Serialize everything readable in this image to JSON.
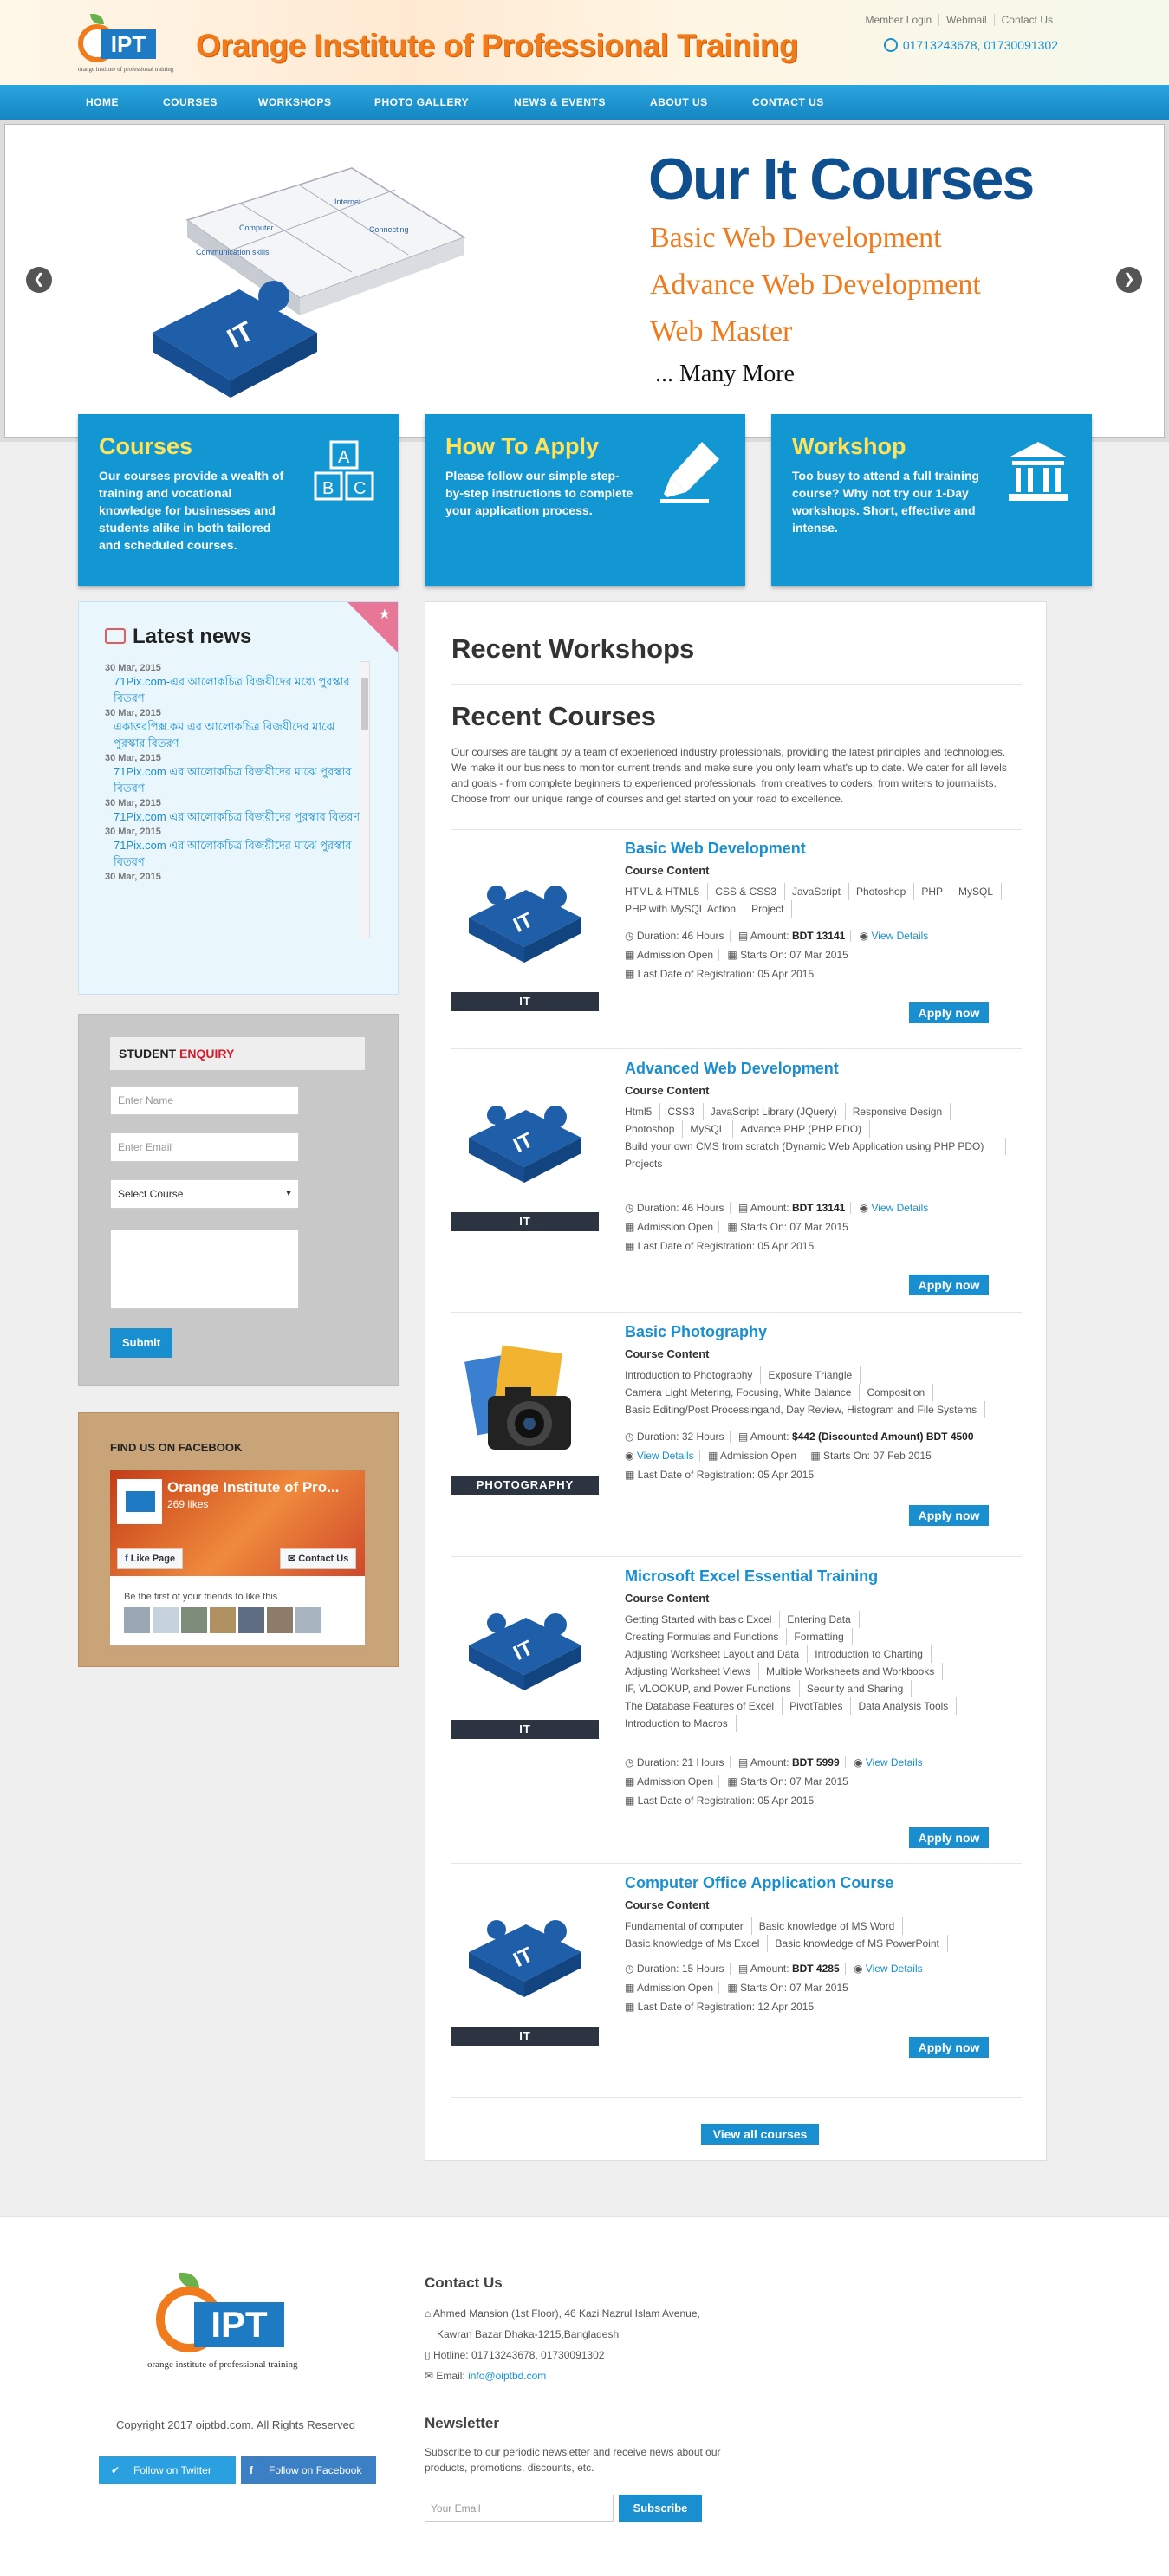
{
  "header": {
    "logo_text": "IPT",
    "logo_tagline": "orange institute of professional training",
    "site_title": "Orange Institute of Professional Training",
    "top_links": [
      "Member Login",
      "Webmail",
      "Contact Us"
    ],
    "hotline": "01713243678, 01730091302"
  },
  "nav": [
    "HOME",
    "COURSES",
    "WORKSHOPS",
    "PHOTO GALLERY",
    "NEWS & EVENTS",
    "ABOUT US",
    "CONTACT US"
  ],
  "slider": {
    "heading": "Our It Courses",
    "lines": [
      "Basic Web Development",
      "Advance Web Development",
      "Web Master"
    ],
    "more": "... Many More",
    "puzzle_label": "IT",
    "puzzle_words": [
      "Computer",
      "Internet",
      "Connecting",
      "Communication skills"
    ]
  },
  "features": [
    {
      "title": "Courses",
      "text": "Our courses provide a wealth of training and vocational knowledge for businesses and students alike in both tailored and scheduled courses.",
      "icon": "abc-blocks-icon"
    },
    {
      "title": "How To Apply",
      "text": "Please follow our simple step-by-step instructions to complete your application process.",
      "icon": "marker-icon"
    },
    {
      "title": "Workshop",
      "text": "Too busy to attend a full training course? Why not try our 1-Day workshops. Short, effective and intense.",
      "icon": "institution-icon"
    }
  ],
  "news": {
    "title": "Latest news",
    "items": [
      {
        "date": "30 Mar, 2015",
        "text": "71Pix.com-এর আলোকচিত্র বিজয়ীদের মধ্যে পুরস্কার বিতরণ"
      },
      {
        "date": "30 Mar, 2015",
        "text": "একাত্তরপিক্স.কম এর আলোকচিত্র বিজয়ীদের মাঝে পুরস্কার বিতরণ"
      },
      {
        "date": "30 Mar, 2015",
        "text": "71Pix.com এর আলোকচিত্র বিজয়ীদের মাঝে পুরস্কার বিতরণ"
      },
      {
        "date": "30 Mar, 2015",
        "text": "71Pix.com এর আলোকচিত্র বিজয়ীদের পুরস্কার বিতরণ"
      },
      {
        "date": "30 Mar, 2015",
        "text": "71Pix.com এর আলোকচিত্র বিজয়ীদের মাঝে পুরস্কার বিতরণ"
      },
      {
        "date": "30 Mar, 2015",
        "text": ""
      }
    ]
  },
  "enquiry": {
    "title_a": "STUDENT",
    "title_b": "ENQUIRY",
    "name_ph": "Enter Name",
    "email_ph": "Enter Email",
    "course_select": "Select Course",
    "submit": "Submit"
  },
  "facebook": {
    "heading": "FIND US ON FACEBOOK",
    "page_name": "Orange Institute of Pro...",
    "likes": "269 likes",
    "like_btn": "Like Page",
    "contact_btn": "Contact Us",
    "friends": "Be the first of your friends to like this"
  },
  "main": {
    "workshops_title": "Recent Workshops",
    "courses_title": "Recent Courses",
    "intro": "Our courses are taught by a team of experienced industry professionals, providing the latest principles and technologies. We make it our business to monitor current trends and make sure you only learn what's up to date. We cater for all levels and goals - from complete beginners to experienced professionals, from creatives to coders, from writers to journalists. Choose from our unique range of courses and get started on your road to excellence.",
    "content_label": "Course Content",
    "view_all": "View all courses",
    "apply": "Apply now",
    "view_details": "View Details"
  },
  "courses": [
    {
      "title": "Basic Web Development",
      "label": "IT",
      "topics": [
        "HTML & HTML5",
        "CSS & CSS3",
        "JavaScript",
        "Photoshop",
        "PHP",
        "MySQL",
        "PHP with MySQL Action",
        "Project"
      ],
      "duration": "Duration: 46 Hours",
      "amount_label": "Amount:",
      "amount": "BDT 13141",
      "admission": "Admission Open",
      "starts": "Starts On: 07 Mar 2015",
      "last_date": "Last Date of Registration: 05 Apr 2015"
    },
    {
      "title": "Advanced Web Development",
      "label": "IT",
      "topics": [
        "Html5",
        "CSS3",
        "JavaScript Library (JQuery)",
        "Responsive Design",
        "Photoshop",
        "MySQL",
        "Advance PHP (PHP PDO)",
        "Build your own CMS from scratch (Dynamic Web Application using PHP PDO)",
        "Projects"
      ],
      "duration": "Duration: 46 Hours",
      "amount_label": "Amount:",
      "amount": "BDT 13141",
      "admission": "Admission Open",
      "starts": "Starts On: 07 Mar 2015",
      "last_date": "Last Date of Registration: 05 Apr 2015"
    },
    {
      "title": "Basic Photography",
      "label": "PHOTOGRAPHY",
      "topics": [
        "Introduction to Photography",
        "Exposure Triangle",
        "Camera Light Metering, Focusing, White Balance",
        "Composition",
        "Basic Editing/Post Processingand, Day Review, Histogram and File Systems"
      ],
      "duration": "Duration: 32 Hours",
      "amount_label": "Amount:",
      "amount": "$442 (Discounted Amount) BDT 4500",
      "admission": "Admission Open",
      "starts": "Starts On: 07 Feb 2015",
      "last_date": "Last Date of Registration: 05 Apr 2015"
    },
    {
      "title": "Microsoft Excel Essential Training",
      "label": "IT",
      "topics": [
        "Getting Started with basic Excel",
        "Entering Data",
        "Creating Formulas and Functions",
        "Formatting",
        "Adjusting Worksheet Layout and Data",
        "Introduction to Charting",
        "Adjusting Worksheet Views",
        "Multiple Worksheets and Workbooks",
        "IF, VLOOKUP, and Power Functions",
        "Security and Sharing",
        "The Database Features of Excel",
        "PivotTables",
        "Data Analysis Tools",
        "Introduction to Macros"
      ],
      "duration": "Duration: 21 Hours",
      "amount_label": "Amount:",
      "amount": "BDT 5999",
      "admission": "Admission Open",
      "starts": "Starts On: 07 Mar 2015",
      "last_date": "Last Date of Registration: 05 Apr 2015"
    },
    {
      "title": "Computer Office Application Course",
      "label": "IT",
      "topics": [
        "Fundamental of computer",
        "Basic knowledge of MS Word",
        "Basic knowledge of Ms Excel",
        "Basic knowledge of MS PowerPoint"
      ],
      "duration": "Duration: 15 Hours",
      "amount_label": "Amount:",
      "amount": "BDT 4285",
      "admission": "Admission Open",
      "starts": "Starts On: 07 Mar 2015",
      "last_date": "Last Date of Registration: 12 Apr 2015"
    }
  ],
  "footer": {
    "logo_text": "IPT",
    "tagline": "orange institute of professional training",
    "copyright": "Copyright 2017 oiptbd.com. All Rights Reserved",
    "twitter": "Follow on Twitter",
    "facebook": "Follow on Facebook",
    "contact_title": "Contact Us",
    "address1": "Ahmed Mansion (1st Floor), 46 Kazi Nazrul Islam Avenue,",
    "address2": "Kawran Bazar,Dhaka-1215,Bangladesh",
    "hotline": "Hotline: 01713243678, 01730091302",
    "email_label": "Email:",
    "email": "info@oiptbd.com",
    "newsletter_title": "Newsletter",
    "newsletter_text": "Subscribe to our periodic newsletter and receive news about our products, promotions, discounts, etc.",
    "email_ph": "Your Email",
    "subscribe": "Subscribe"
  }
}
